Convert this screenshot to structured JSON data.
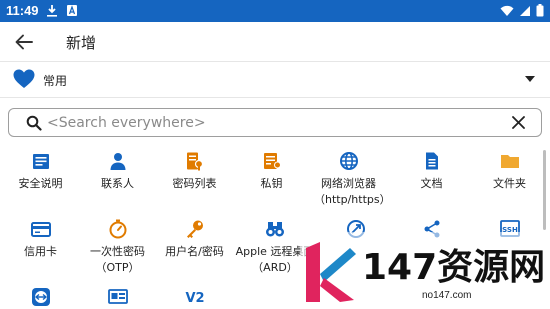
{
  "status_bar": {
    "time": "11:49",
    "bg_color": "#1565c0"
  },
  "app_bar": {
    "title": "新增"
  },
  "group": {
    "label": "常用",
    "icon": "heart-icon",
    "icon_color": "#1565c0"
  },
  "search": {
    "placeholder": "<Search everywhere>",
    "value": ""
  },
  "accent_color": "#e07b00",
  "blue_color": "#1565c0",
  "grid_items": [
    {
      "label": "安全说明",
      "icon": "note-icon"
    },
    {
      "label": "联系人",
      "icon": "contact-icon"
    },
    {
      "label": "密码列表",
      "icon": "password-list-icon"
    },
    {
      "label": "私钥",
      "icon": "private-key-icon"
    },
    {
      "label": "网络浏览器（http/https）",
      "icon": "globe-icon"
    },
    {
      "label": "文档",
      "icon": "document-icon"
    },
    {
      "label": "文件夹",
      "icon": "folder-icon"
    },
    {
      "label": "信用卡",
      "icon": "credit-card-icon"
    },
    {
      "label": "一次性密码（OTP）",
      "icon": "otp-timer-icon"
    },
    {
      "label": "用户名/密码",
      "icon": "key-icon"
    },
    {
      "label": "Apple 远程桌面 （ARD）",
      "icon": "binoculars-icon"
    },
    {
      "label": "",
      "icon": "remote-desktop-icon"
    },
    {
      "label": "",
      "icon": "share-icon"
    },
    {
      "label": "",
      "icon": "ssh-icon"
    },
    {
      "label": "",
      "icon": "teamviewer-icon"
    },
    {
      "label": "",
      "icon": "window-icon"
    },
    {
      "label": "",
      "icon": "vnc-icon"
    }
  ],
  "watermark": {
    "text": "147资源网",
    "sub": "no147.com"
  }
}
